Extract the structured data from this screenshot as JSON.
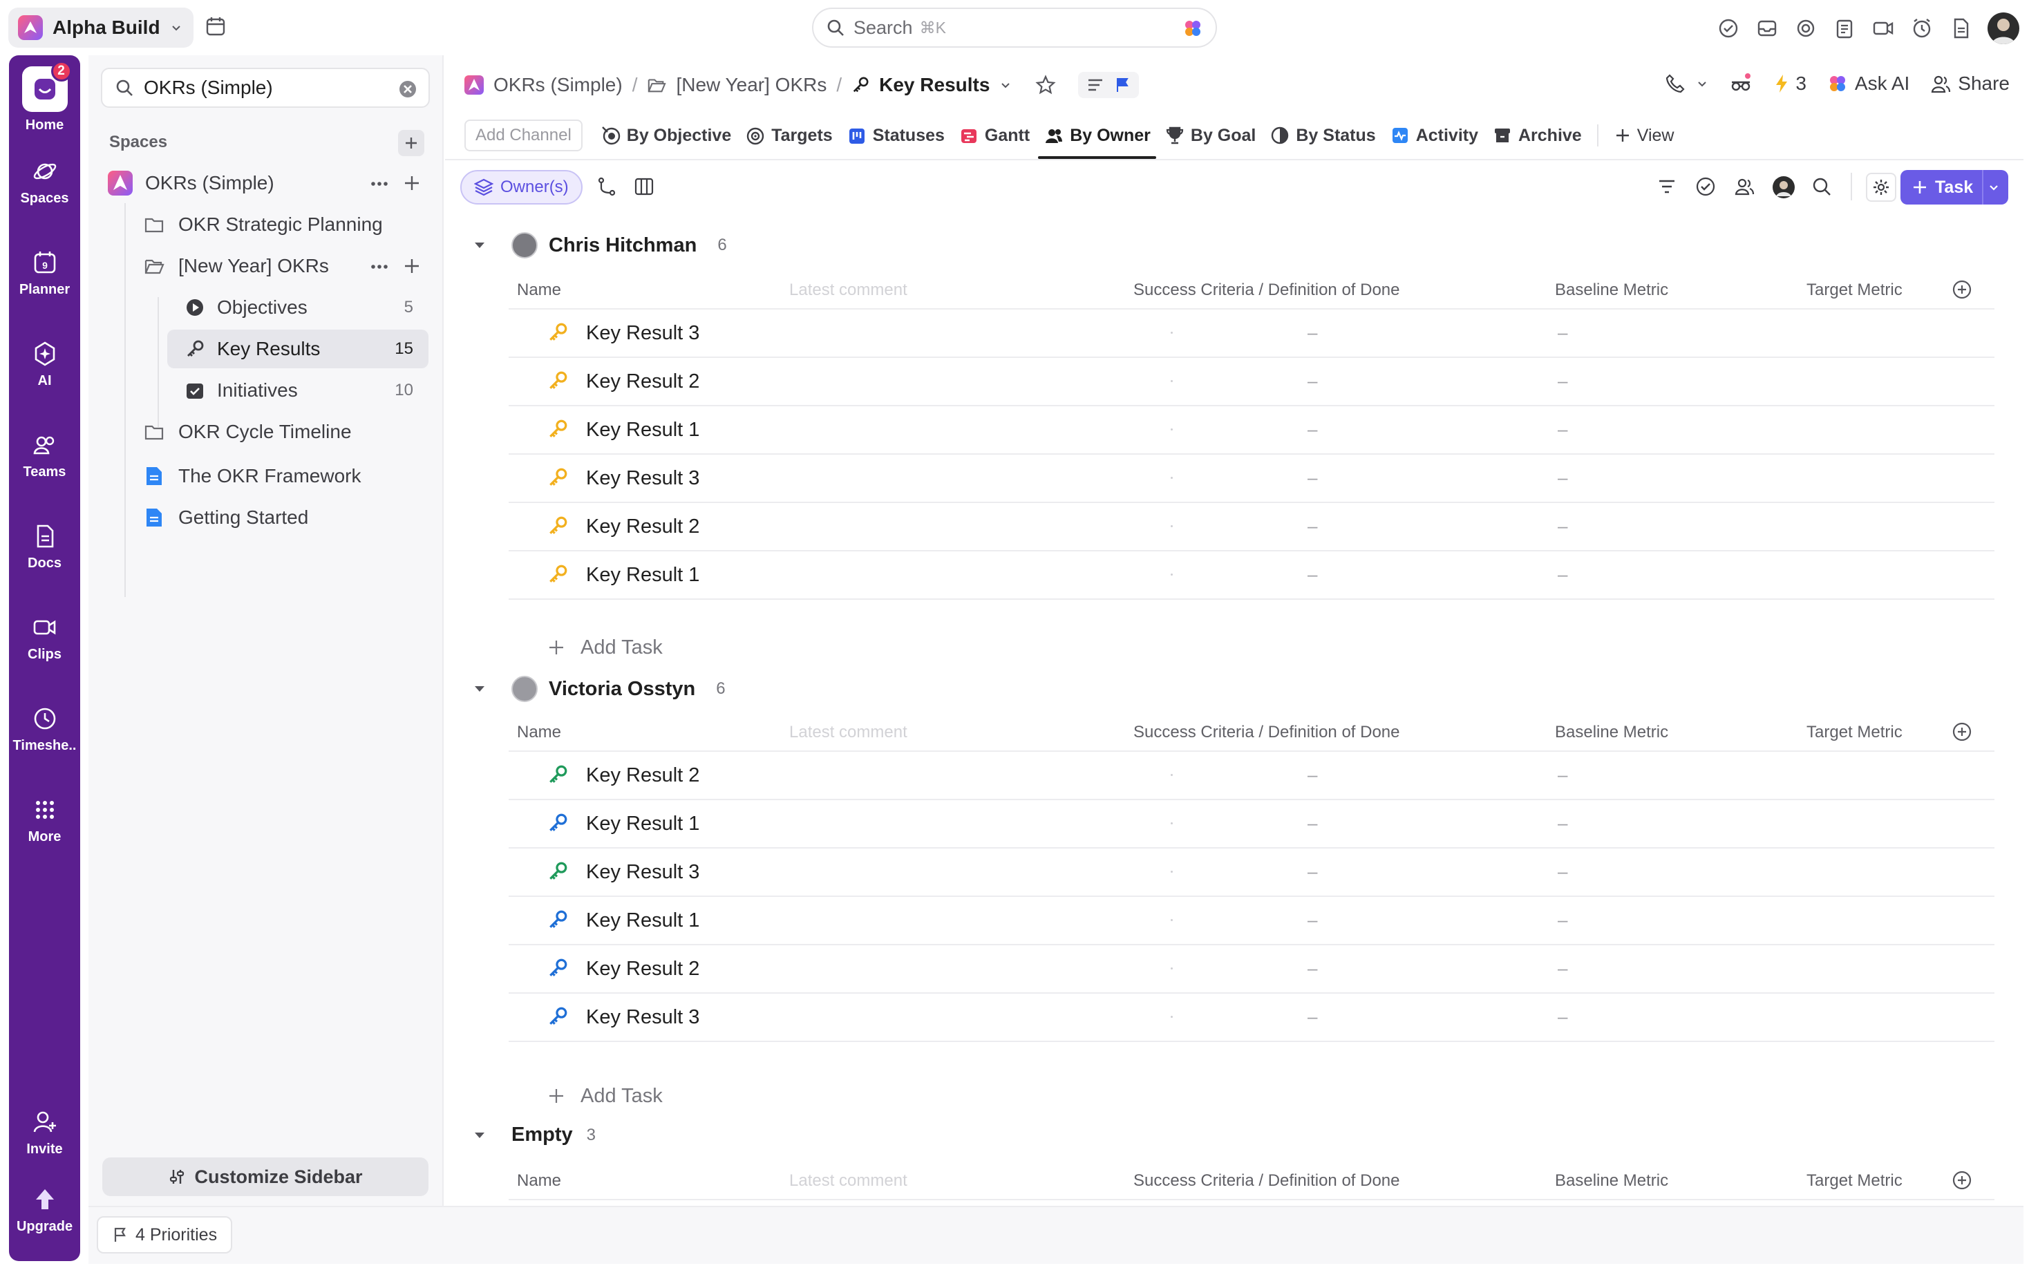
{
  "workspace": {
    "name": "Alpha Build"
  },
  "search": {
    "placeholder": "Search",
    "shortcut": "⌘K"
  },
  "rail": {
    "home_badge": "2",
    "items": [
      {
        "label": "Home"
      },
      {
        "label": "Spaces"
      },
      {
        "label": "Planner"
      },
      {
        "label": "AI"
      },
      {
        "label": "Teams"
      },
      {
        "label": "Docs"
      },
      {
        "label": "Clips"
      },
      {
        "label": "Timeshe.."
      },
      {
        "label": "More"
      }
    ],
    "invite": "Invite",
    "upgrade": "Upgrade"
  },
  "sidebar": {
    "search_value": "OKRs (Simple)",
    "spaces_header": "Spaces",
    "space_name": "OKRs (Simple)",
    "items": [
      {
        "label": "OKR Strategic Planning"
      },
      {
        "label": "[New Year] OKRs"
      },
      {
        "label": "Objectives",
        "count": "5"
      },
      {
        "label": "Key Results",
        "count": "15"
      },
      {
        "label": "Initiatives",
        "count": "10"
      },
      {
        "label": "OKR Cycle Timeline"
      },
      {
        "label": "The OKR Framework"
      },
      {
        "label": "Getting Started"
      }
    ],
    "customize": "Customize Sidebar"
  },
  "bottom": {
    "priorities": "4 Priorities"
  },
  "breadcrumb": {
    "space": "OKRs (Simple)",
    "folder": "[New Year] OKRs",
    "list": "Key Results"
  },
  "header": {
    "notif_count": "3",
    "ask_ai": "Ask AI",
    "share": "Share"
  },
  "views": {
    "add_channel": "Add Channel",
    "tabs": [
      "By Objective",
      "Targets",
      "Statuses",
      "Gantt",
      "By Owner",
      "By Goal",
      "By Status",
      "Activity",
      "Archive"
    ],
    "add_view": "View"
  },
  "toolbar": {
    "group_by": "Owner(s)",
    "task_button": "Task"
  },
  "columns": {
    "name": "Name",
    "latest_comment": "Latest comment",
    "success": "Success Criteria / Definition of Done",
    "baseline": "Baseline Metric",
    "target": "Target Metric"
  },
  "groups": [
    {
      "name": "Chris Hitchman",
      "count": "6",
      "rows": [
        {
          "name": "Key Result 3"
        },
        {
          "name": "Key Result 2"
        },
        {
          "name": "Key Result 1"
        },
        {
          "name": "Key Result 3"
        },
        {
          "name": "Key Result 2"
        },
        {
          "name": "Key Result 1"
        }
      ],
      "add": "Add Task"
    },
    {
      "name": "Victoria Osstyn",
      "count": "6",
      "rows": [
        {
          "name": "Key Result 2"
        },
        {
          "name": "Key Result 1"
        },
        {
          "name": "Key Result 3"
        },
        {
          "name": "Key Result 1"
        },
        {
          "name": "Key Result 2"
        },
        {
          "name": "Key Result 3"
        }
      ],
      "add": "Add Task"
    },
    {
      "name": "Empty",
      "count": "3"
    }
  ],
  "empty_value": "–",
  "colors": {
    "rail": "#5b1f8f",
    "accent": "#6a5be6",
    "key_yellow": "#f2b01e",
    "key_green": "#1f9a5b",
    "key_blue": "#1f6fd6"
  }
}
